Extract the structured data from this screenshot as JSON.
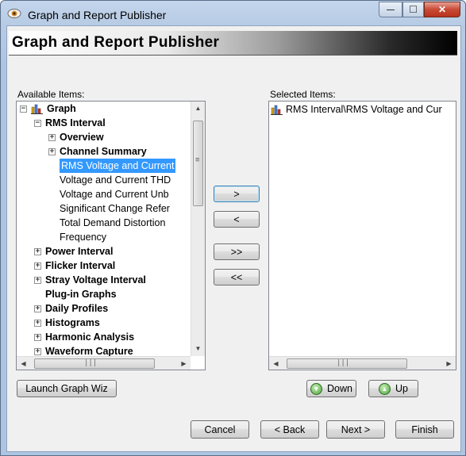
{
  "window": {
    "title": "Graph and Report Publisher",
    "controls": {
      "minimize": "—",
      "maximize": "☐",
      "close": "✕"
    }
  },
  "banner": {
    "title": "Graph and Report Publisher"
  },
  "available": {
    "label": "Available Items:",
    "tree": [
      {
        "label": "Graph",
        "bold": true,
        "expander": "⊟",
        "level": 0,
        "icon": "chart-icon"
      },
      {
        "label": "RMS Interval",
        "bold": true,
        "expander": "⊟",
        "level": 1
      },
      {
        "label": "Overview",
        "bold": true,
        "expander": "⊞",
        "level": 2
      },
      {
        "label": "Channel Summary",
        "bold": true,
        "expander": "⊞",
        "level": 2
      },
      {
        "label": "RMS Voltage and Current",
        "bold": false,
        "selected": true,
        "level": 2
      },
      {
        "label": "Voltage and Current THD",
        "bold": false,
        "level": 2
      },
      {
        "label": "Voltage and Current Unb",
        "bold": false,
        "level": 2
      },
      {
        "label": "Significant Change Refer",
        "bold": false,
        "level": 2
      },
      {
        "label": "Total Demand Distortion",
        "bold": false,
        "level": 2
      },
      {
        "label": "Frequency",
        "bold": false,
        "level": 2
      },
      {
        "label": "Power Interval",
        "bold": true,
        "expander": "⊞",
        "level": 1
      },
      {
        "label": "Flicker Interval",
        "bold": true,
        "expander": "⊞",
        "level": 1
      },
      {
        "label": "Stray Voltage Interval",
        "bold": true,
        "expander": "⊞",
        "level": 1
      },
      {
        "label": "Plug-in Graphs",
        "bold": true,
        "level": 1
      },
      {
        "label": "Daily Profiles",
        "bold": true,
        "expander": "⊞",
        "level": 1
      },
      {
        "label": "Histograms",
        "bold": true,
        "expander": "⊞",
        "level": 1
      },
      {
        "label": "Harmonic Analysis",
        "bold": true,
        "expander": "⊞",
        "level": 1
      },
      {
        "label": "Waveform Capture",
        "bold": true,
        "expander": "⊞",
        "level": 1
      }
    ]
  },
  "selected": {
    "label": "Selected Items:",
    "items": [
      {
        "label": "RMS Interval\\RMS Voltage and Cur",
        "icon": "chart-icon"
      }
    ]
  },
  "transfer_buttons": {
    "add": ">",
    "remove": "<",
    "add_all": ">>",
    "remove_all": "<<"
  },
  "launch_button": "Launch  Graph Wiz",
  "order_buttons": {
    "down": "Down",
    "up": "Up"
  },
  "nav_buttons": {
    "cancel": "Cancel",
    "back": "< Back",
    "next": "Next >",
    "finish": "Finish"
  },
  "scroll_glyphs": {
    "up": "▲",
    "down": "▼",
    "left": "◀",
    "right": "▶",
    "grip_v": "≡",
    "grip_h": "|||"
  }
}
